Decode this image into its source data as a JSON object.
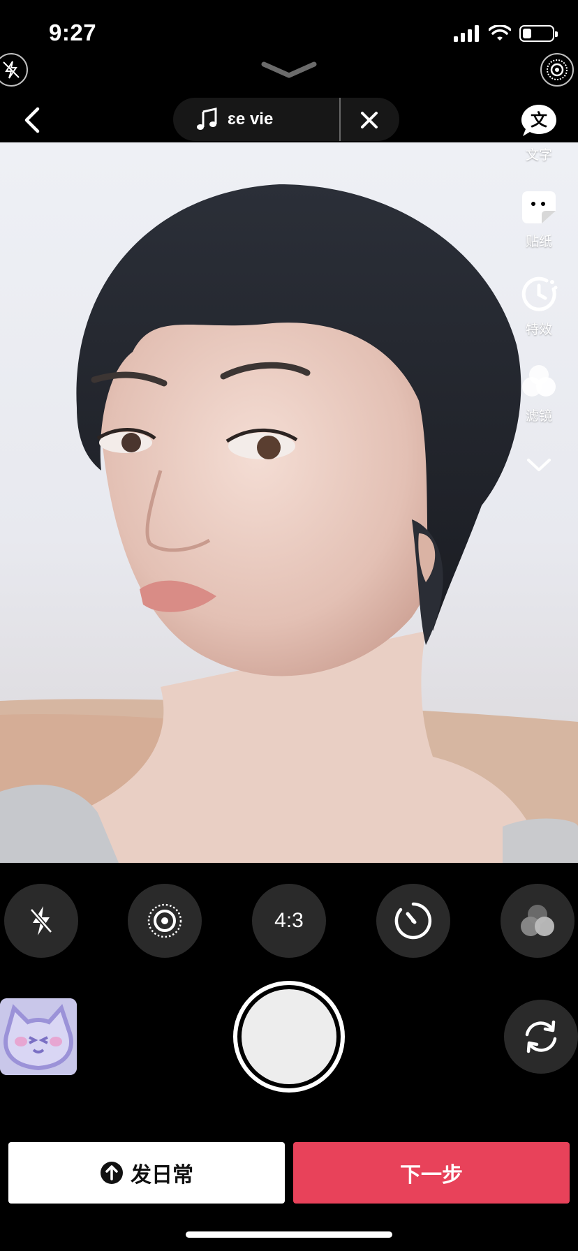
{
  "status": {
    "time": "9:27"
  },
  "top": {
    "music_label": "ɛe vie"
  },
  "rail": [
    {
      "label": "文字",
      "icon": "text-icon"
    },
    {
      "label": "贴纸",
      "icon": "sticker-icon"
    },
    {
      "label": "特效",
      "icon": "effects-icon"
    },
    {
      "label": "滤镜",
      "icon": "filter-icon"
    }
  ],
  "controls": {
    "ratio": "4:3"
  },
  "bottom": {
    "daily_label": "发日常",
    "next_label": "下一步"
  },
  "colors": {
    "accent": "#e8425a"
  }
}
